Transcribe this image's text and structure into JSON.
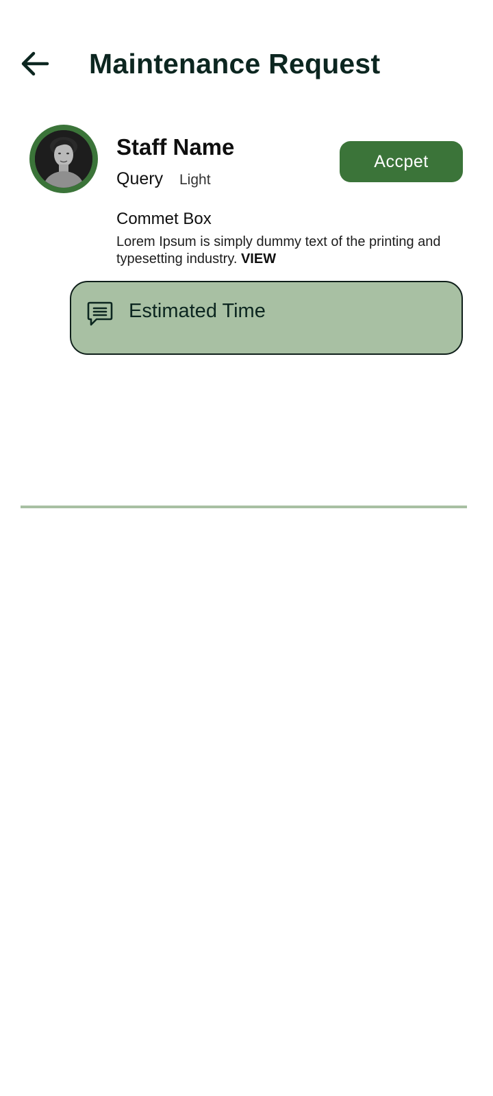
{
  "header": {
    "title": "Maintenance Request",
    "back_icon": "arrow-left-icon"
  },
  "request": {
    "staff_name": "Staff Name",
    "query_label": "Query",
    "query_value": "Light",
    "accept_label": "Accpet",
    "comment_title": "Commet Box",
    "comment_text": "Lorem Ipsum is simply dummy text of the printing and typesetting industry.",
    "view_label": "VIEW",
    "estimated_time_label": "Estimated Time",
    "estimated_time_icon": "chat-bubble-icon"
  },
  "colors": {
    "primary_green": "#3b7439",
    "light_green": "#a8c0a3",
    "title_dark": "#0c2620"
  }
}
